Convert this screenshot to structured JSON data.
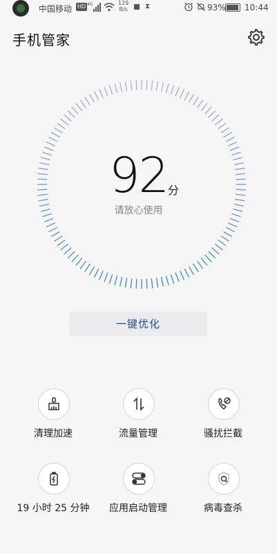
{
  "statusbar": {
    "carrier": "中国移动",
    "hd": "HD",
    "speed_value": "129",
    "speed_unit": "B/s",
    "battery_pct": "93%",
    "battery_level": 0.93,
    "time": "10:44",
    "icons": [
      "avatar",
      "signal-icon",
      "wifi-icon",
      "square-icon",
      "hourglass-icon",
      "alarm-icon",
      "mute-icon",
      "battery-icon"
    ]
  },
  "header": {
    "title": "手机管家",
    "settings_icon": "gear-icon"
  },
  "score": {
    "value": "92",
    "unit": "分",
    "subtitle": "请放心使用"
  },
  "optimize_button": "一键优化",
  "tools": [
    {
      "label": "清理加速",
      "icon": "broom-icon"
    },
    {
      "label": "流量管理",
      "icon": "updown-arrows-icon"
    },
    {
      "label": "骚扰拦截",
      "icon": "blocked-call-icon"
    },
    {
      "label": "19 小时 25 分钟",
      "icon": "battery-bolt-icon"
    },
    {
      "label": "应用启动管理",
      "icon": "toggle-switches-icon"
    },
    {
      "label": "病毒查杀",
      "icon": "shield-search-icon"
    }
  ],
  "colors": {
    "accent": "#1f4f9c",
    "dial_tick_start": "#b7a6d6",
    "dial_tick_end": "#3a88c9",
    "background": "#f6f6f7"
  }
}
